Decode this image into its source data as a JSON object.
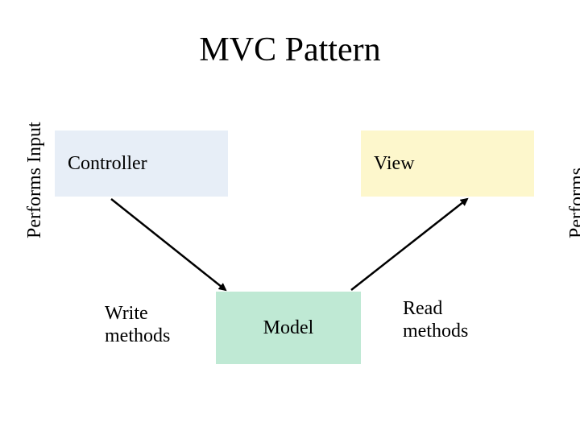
{
  "title": "MVC Pattern",
  "boxes": {
    "controller": "Controller",
    "view": "View",
    "model": "Model"
  },
  "labels": {
    "write": "Write methods",
    "read": "Read methods",
    "input_side": "Performs Input",
    "output_side": "Performs Output"
  },
  "colors": {
    "controller_fill": "#e7eef7",
    "view_fill": "#fdf7cc",
    "model_fill": "#bfe9d4"
  }
}
